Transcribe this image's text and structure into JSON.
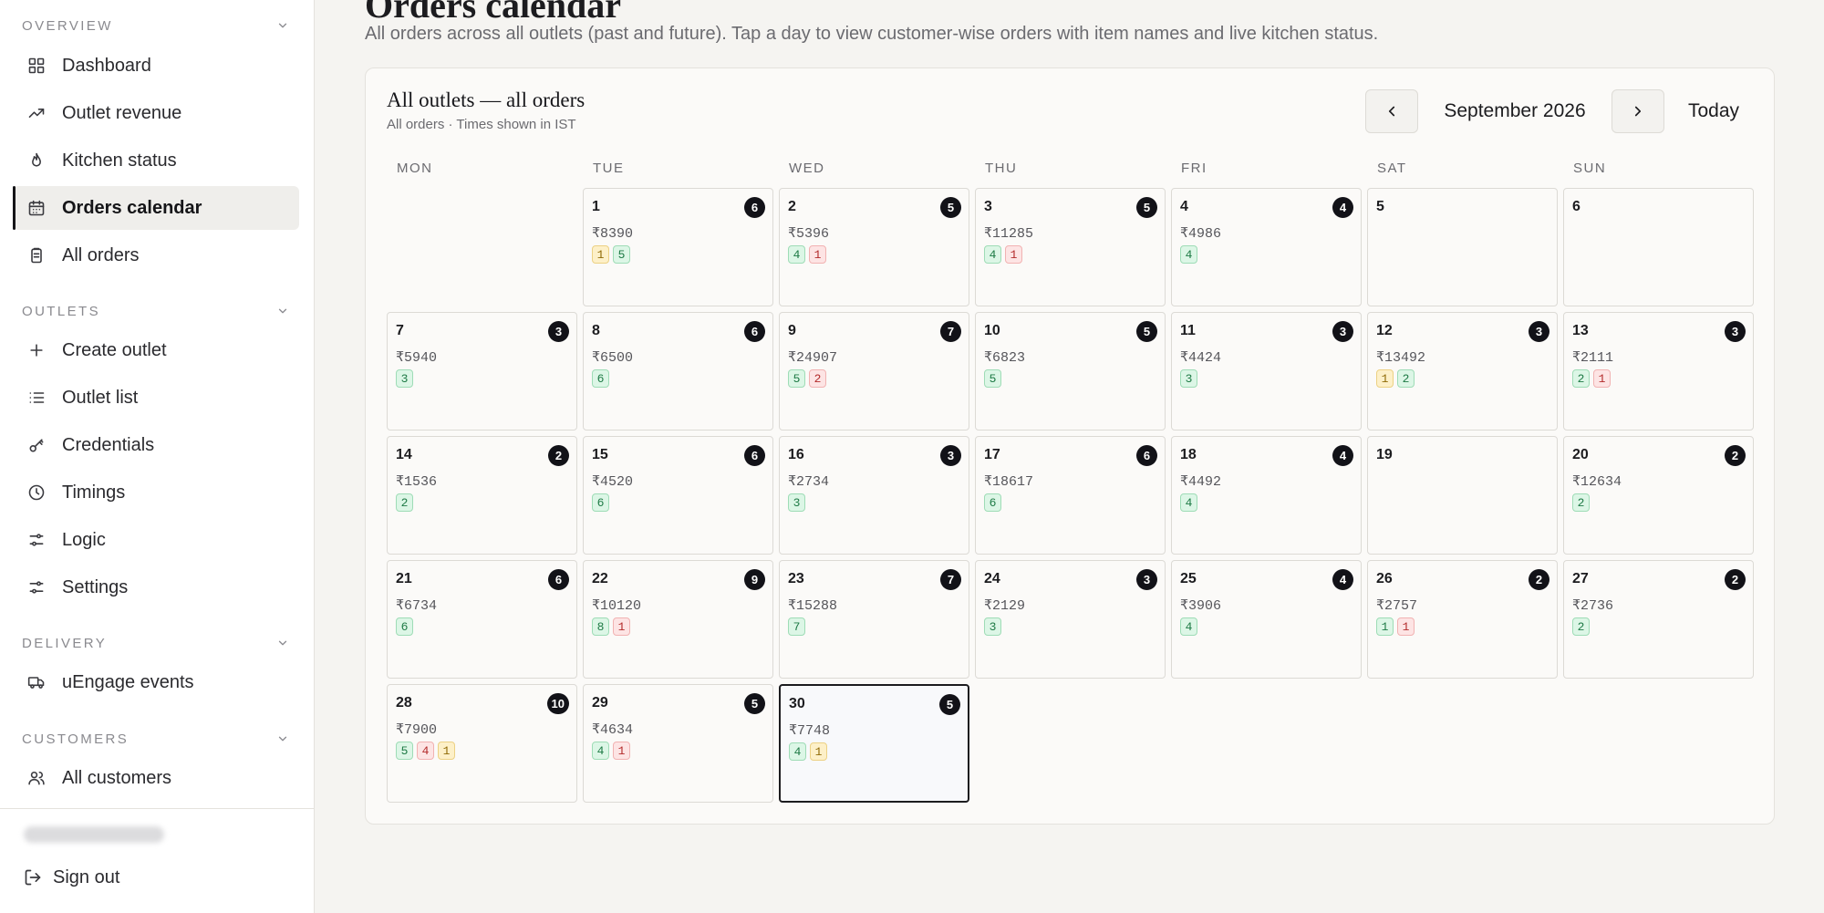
{
  "sidebar": {
    "groups": [
      {
        "id": "overview",
        "title": "OVERVIEW",
        "items": [
          {
            "label": "Dashboard",
            "icon": "dashboard-grid-icon"
          },
          {
            "label": "Outlet revenue",
            "icon": "trending-up-icon"
          },
          {
            "label": "Kitchen status",
            "icon": "flame-icon"
          },
          {
            "label": "Orders calendar",
            "icon": "calendar-icon",
            "active": true
          },
          {
            "label": "All orders",
            "icon": "clipboard-icon"
          }
        ]
      },
      {
        "id": "outlets",
        "title": "OUTLETS",
        "items": [
          {
            "label": "Create outlet",
            "icon": "plus-icon"
          },
          {
            "label": "Outlet list",
            "icon": "list-icon"
          },
          {
            "label": "Credentials",
            "icon": "key-icon"
          },
          {
            "label": "Timings",
            "icon": "clock-icon"
          },
          {
            "label": "Logic",
            "icon": "sliders-icon"
          },
          {
            "label": "Settings",
            "icon": "sliders-icon"
          }
        ]
      },
      {
        "id": "delivery",
        "title": "DELIVERY",
        "items": [
          {
            "label": "uEngage events",
            "icon": "truck-icon"
          }
        ]
      },
      {
        "id": "customers",
        "title": "CUSTOMERS",
        "items": [
          {
            "label": "All customers",
            "icon": "users-icon"
          }
        ]
      }
    ],
    "sign_out_label": "Sign out"
  },
  "page": {
    "title": "Orders calendar",
    "description": "All orders across all outlets (past and future). Tap a day to view customer-wise orders with item names and live kitchen status."
  },
  "calendar": {
    "title": "All outlets — all orders",
    "subtitle": "All orders · Times shown in IST",
    "month_label": "September 2026",
    "today_label": "Today",
    "weekdays": [
      "MON",
      "TUE",
      "WED",
      "THU",
      "FRI",
      "SAT",
      "SUN"
    ],
    "first_weekday_index": 1,
    "selected_day": 30,
    "badge_colors": {
      "green": "#dcf6e6",
      "red": "#fde4e4",
      "yellow": "#fdf0c8",
      "count": "#121218"
    },
    "days": [
      {
        "day": "1",
        "count": "6",
        "amount": "₹8390",
        "badges": [
          {
            "v": "1",
            "c": "yellow"
          },
          {
            "v": "5",
            "c": "green"
          }
        ]
      },
      {
        "day": "2",
        "count": "5",
        "amount": "₹5396",
        "badges": [
          {
            "v": "4",
            "c": "green"
          },
          {
            "v": "1",
            "c": "red"
          }
        ]
      },
      {
        "day": "3",
        "count": "5",
        "amount": "₹11285",
        "badges": [
          {
            "v": "4",
            "c": "green"
          },
          {
            "v": "1",
            "c": "red"
          }
        ]
      },
      {
        "day": "4",
        "count": "4",
        "amount": "₹4986",
        "badges": [
          {
            "v": "4",
            "c": "green"
          }
        ]
      },
      {
        "day": "5",
        "count": "",
        "amount": "",
        "badges": []
      },
      {
        "day": "6",
        "count": "",
        "amount": "",
        "badges": []
      },
      {
        "day": "7",
        "count": "3",
        "amount": "₹5940",
        "badges": [
          {
            "v": "3",
            "c": "green"
          }
        ]
      },
      {
        "day": "8",
        "count": "6",
        "amount": "₹6500",
        "badges": [
          {
            "v": "6",
            "c": "green"
          }
        ]
      },
      {
        "day": "9",
        "count": "7",
        "amount": "₹24907",
        "badges": [
          {
            "v": "5",
            "c": "green"
          },
          {
            "v": "2",
            "c": "red"
          }
        ]
      },
      {
        "day": "10",
        "count": "5",
        "amount": "₹6823",
        "badges": [
          {
            "v": "5",
            "c": "green"
          }
        ]
      },
      {
        "day": "11",
        "count": "3",
        "amount": "₹4424",
        "badges": [
          {
            "v": "3",
            "c": "green"
          }
        ]
      },
      {
        "day": "12",
        "count": "3",
        "amount": "₹13492",
        "badges": [
          {
            "v": "1",
            "c": "yellow"
          },
          {
            "v": "2",
            "c": "green"
          }
        ]
      },
      {
        "day": "13",
        "count": "3",
        "amount": "₹2111",
        "badges": [
          {
            "v": "2",
            "c": "green"
          },
          {
            "v": "1",
            "c": "red"
          }
        ]
      },
      {
        "day": "14",
        "count": "2",
        "amount": "₹1536",
        "badges": [
          {
            "v": "2",
            "c": "green"
          }
        ]
      },
      {
        "day": "15",
        "count": "6",
        "amount": "₹4520",
        "badges": [
          {
            "v": "6",
            "c": "green"
          }
        ]
      },
      {
        "day": "16",
        "count": "3",
        "amount": "₹2734",
        "badges": [
          {
            "v": "3",
            "c": "green"
          }
        ]
      },
      {
        "day": "17",
        "count": "6",
        "amount": "₹18617",
        "badges": [
          {
            "v": "6",
            "c": "green"
          }
        ]
      },
      {
        "day": "18",
        "count": "4",
        "amount": "₹4492",
        "badges": [
          {
            "v": "4",
            "c": "green"
          }
        ]
      },
      {
        "day": "19",
        "count": "",
        "amount": "",
        "badges": []
      },
      {
        "day": "20",
        "count": "2",
        "amount": "₹12634",
        "badges": [
          {
            "v": "2",
            "c": "green"
          }
        ]
      },
      {
        "day": "21",
        "count": "6",
        "amount": "₹6734",
        "badges": [
          {
            "v": "6",
            "c": "green"
          }
        ]
      },
      {
        "day": "22",
        "count": "9",
        "amount": "₹10120",
        "badges": [
          {
            "v": "8",
            "c": "green"
          },
          {
            "v": "1",
            "c": "red"
          }
        ]
      },
      {
        "day": "23",
        "count": "7",
        "amount": "₹15288",
        "badges": [
          {
            "v": "7",
            "c": "green"
          }
        ]
      },
      {
        "day": "24",
        "count": "3",
        "amount": "₹2129",
        "badges": [
          {
            "v": "3",
            "c": "green"
          }
        ]
      },
      {
        "day": "25",
        "count": "4",
        "amount": "₹3906",
        "badges": [
          {
            "v": "4",
            "c": "green"
          }
        ]
      },
      {
        "day": "26",
        "count": "2",
        "amount": "₹2757",
        "badges": [
          {
            "v": "1",
            "c": "green"
          },
          {
            "v": "1",
            "c": "red"
          }
        ]
      },
      {
        "day": "27",
        "count": "2",
        "amount": "₹2736",
        "badges": [
          {
            "v": "2",
            "c": "green"
          }
        ]
      },
      {
        "day": "28",
        "count": "10",
        "amount": "₹7900",
        "badges": [
          {
            "v": "5",
            "c": "green"
          },
          {
            "v": "4",
            "c": "red"
          },
          {
            "v": "1",
            "c": "yellow"
          }
        ]
      },
      {
        "day": "29",
        "count": "5",
        "amount": "₹4634",
        "badges": [
          {
            "v": "4",
            "c": "green"
          },
          {
            "v": "1",
            "c": "red"
          }
        ]
      },
      {
        "day": "30",
        "count": "5",
        "amount": "₹7748",
        "badges": [
          {
            "v": "4",
            "c": "green"
          },
          {
            "v": "1",
            "c": "yellow"
          }
        ]
      }
    ]
  }
}
